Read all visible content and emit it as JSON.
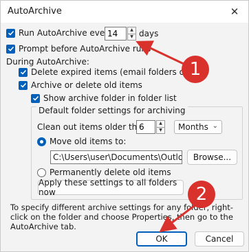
{
  "window": {
    "title": "AutoArchive",
    "close_glyph": "✕"
  },
  "autoarchive": {
    "run_label": "Run AutoArchive every",
    "run_value": "14",
    "run_unit": "days",
    "prompt_label": "Prompt before AutoArchive runs"
  },
  "during": {
    "heading": "During AutoArchive:",
    "delete_expired_label": "Delete expired items (email folders only)",
    "archive_label": "Archive or delete old items",
    "show_folder_label": "Show archive folder in folder list"
  },
  "defaults": {
    "group_title": "Default folder settings for archiving",
    "clean_label": "Clean out items older than",
    "clean_value": "6",
    "clean_unit": "Months",
    "move_label": "Move old items to:",
    "path_value": "C:\\Users\\user\\Documents\\Outlook F",
    "browse_label": "Browse...",
    "permanent_label": "Permanently delete old items",
    "apply_label": "Apply these settings to all folders now"
  },
  "info_text": "To specify different archive settings for any folder, right-click on the folder and choose Properties, then go to the AutoArchive tab.",
  "footer": {
    "ok_label": "OK",
    "cancel_label": "Cancel"
  },
  "annotations": {
    "marker_1": "1",
    "marker_2": "2"
  },
  "colors": {
    "accent": "#005fb8",
    "annotation": "#d9312b"
  }
}
